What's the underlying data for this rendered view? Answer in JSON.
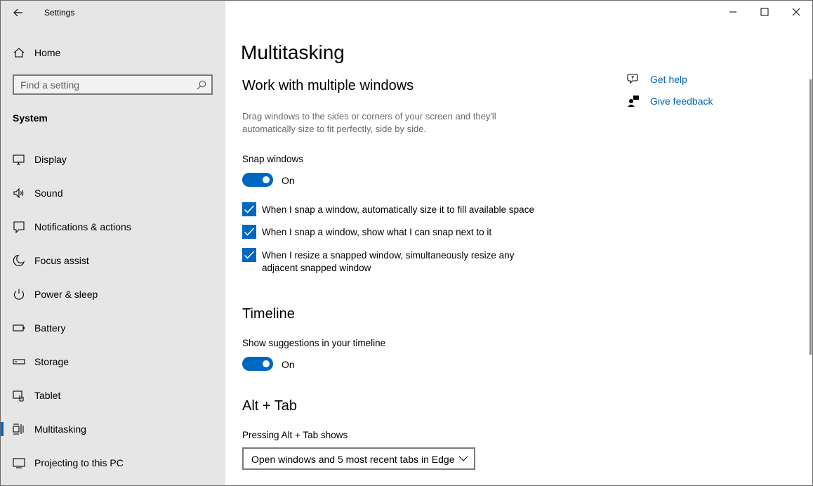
{
  "window": {
    "title": "Settings",
    "controls": {
      "minimize": "minimize",
      "maximize": "maximize",
      "close": "close"
    }
  },
  "sidebar": {
    "home_label": "Home",
    "search_placeholder": "Find a setting",
    "section": "System",
    "items": [
      {
        "label": "Display",
        "icon": "display-icon"
      },
      {
        "label": "Sound",
        "icon": "speaker-icon"
      },
      {
        "label": "Notifications & actions",
        "icon": "notifications-icon"
      },
      {
        "label": "Focus assist",
        "icon": "moon-icon"
      },
      {
        "label": "Power & sleep",
        "icon": "power-icon"
      },
      {
        "label": "Battery",
        "icon": "battery-icon"
      },
      {
        "label": "Storage",
        "icon": "storage-icon"
      },
      {
        "label": "Tablet",
        "icon": "tablet-icon"
      },
      {
        "label": "Multitasking",
        "icon": "multitasking-icon",
        "selected": true
      },
      {
        "label": "Projecting to this PC",
        "icon": "projecting-icon"
      }
    ]
  },
  "main": {
    "title": "Multitasking",
    "snap": {
      "heading": "Work with multiple windows",
      "description": "Drag windows to the sides or corners of your screen and they'll automatically size to fit perfectly, side by side.",
      "toggle_label": "Snap windows",
      "toggle_state": "On",
      "checkboxes": [
        {
          "label": "When I snap a window, automatically size it to fill available space",
          "checked": true
        },
        {
          "label": "When I snap a window, show what I can snap next to it",
          "checked": true
        },
        {
          "label": "When I resize a snapped window, simultaneously resize any adjacent snapped window",
          "checked": true
        }
      ]
    },
    "timeline": {
      "heading": "Timeline",
      "toggle_label": "Show suggestions in your timeline",
      "toggle_state": "On"
    },
    "alttab": {
      "heading": "Alt + Tab",
      "label": "Pressing Alt + Tab shows",
      "selected": "Open windows and 5 most recent tabs in Edge"
    },
    "help": {
      "get_help": "Get help",
      "give_feedback": "Give feedback"
    }
  },
  "colors": {
    "accent": "#0067c0",
    "link": "#0063b1",
    "sidebar_bg": "#e6e6e6"
  }
}
